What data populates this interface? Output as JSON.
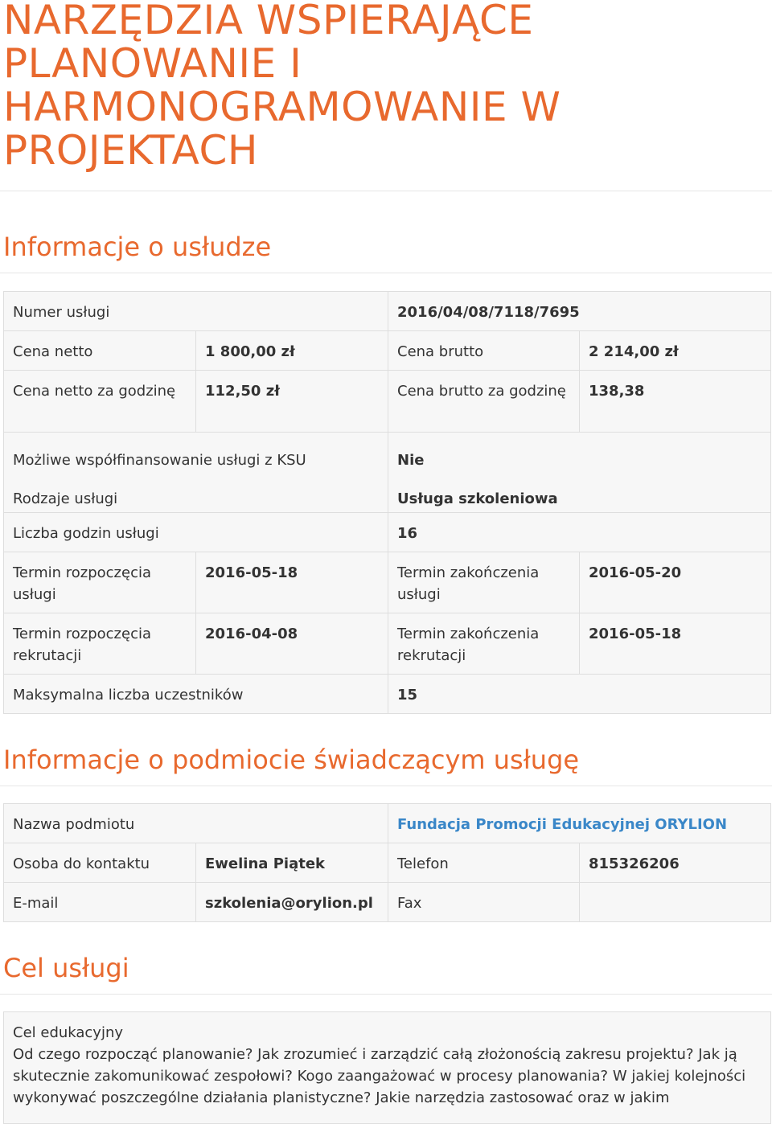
{
  "title": "NARZĘDZIA WSPIERAJĄCE PLANOWANIE I HARMONOGRAMOWANIE W PROJEKTACH",
  "sections": {
    "service_info": "Informacje o usłudze",
    "provider_info": "Informacje o podmiocie świadczącym usługę",
    "goal": "Cel usługi"
  },
  "service": {
    "number_label": "Numer usługi",
    "number": "2016/04/08/7118/7695",
    "net_price_label": "Cena netto",
    "net_price": "1 800,00 zł",
    "gross_price_label": "Cena brutto",
    "gross_price": "2 214,00 zł",
    "net_hour_label": "Cena netto za godzinę",
    "net_hour": "112,50 zł",
    "gross_hour_label": "Cena brutto za godzinę",
    "gross_hour": "138,38",
    "cofinancing_label": "Możliwe współfinansowanie usługi z KSU",
    "cofinancing": "Nie",
    "type_label": "Rodzaje usługi",
    "type": "Usługa szkoleniowa",
    "hours_label": "Liczba godzin usługi",
    "hours": "16",
    "start_label": "Termin rozpoczęcia usługi",
    "start": "2016-05-18",
    "end_label": "Termin zakończenia usługi",
    "end": "2016-05-20",
    "rec_start_label": "Termin rozpoczęcia rekrutacji",
    "rec_start": "2016-04-08",
    "rec_end_label": "Termin zakończenia rekrutacji",
    "rec_end": "2016-05-18",
    "max_label": "Maksymalna liczba uczestników",
    "max": "15"
  },
  "provider": {
    "name_label": "Nazwa podmiotu",
    "name": "Fundacja Promocji Edukacyjnej ORYLION",
    "contact_label": "Osoba do kontaktu",
    "contact": "Ewelina Piątek",
    "phone_label": "Telefon",
    "phone": "815326206",
    "email_label": "E-mail",
    "email": "szkolenia@orylion.pl",
    "fax_label": "Fax",
    "fax": ""
  },
  "goal": {
    "label": "Cel edukacyjny",
    "text": "Od czego rozpocząć planowanie? Jak zrozumieć i zarządzić całą złożonością zakresu projektu? Jak ją skutecznie zakomunikować zespołowi? Kogo zaangażować w procesy planowania? W jakiej kolejności wykonywać poszczególne działania planistyczne? Jakie narzędzia zastosować oraz w jakim"
  }
}
